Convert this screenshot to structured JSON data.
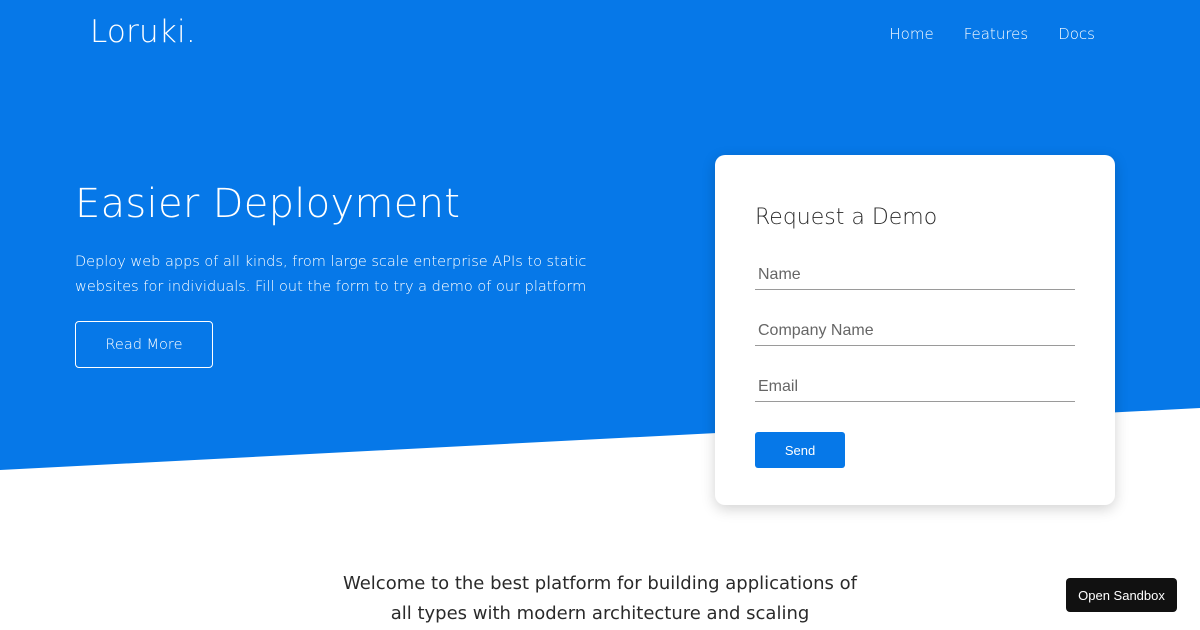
{
  "brand": {
    "logo_text": "Loruki."
  },
  "nav": {
    "items": [
      "Home",
      "Features",
      "Docs"
    ]
  },
  "hero": {
    "title": "Easier Deployment",
    "description": "Deploy web apps of all kinds, from large scale enterprise APIs to static websites for individuals. Fill out the form to try a demo of our platform",
    "read_more_label": "Read More"
  },
  "demo_form": {
    "title": "Request a Demo",
    "name_placeholder": "Name",
    "company_placeholder": "Company Name",
    "email_placeholder": "Email",
    "send_label": "Send"
  },
  "welcome": {
    "text": "Welcome to the best platform for building applications of all types with modern architecture and scaling"
  },
  "sandbox": {
    "label": "Open Sandbox"
  },
  "colors": {
    "primary": "#0678e8",
    "background": "#ffffff",
    "text_dark": "#2a2a2a",
    "sandbox_bg": "#111111"
  }
}
